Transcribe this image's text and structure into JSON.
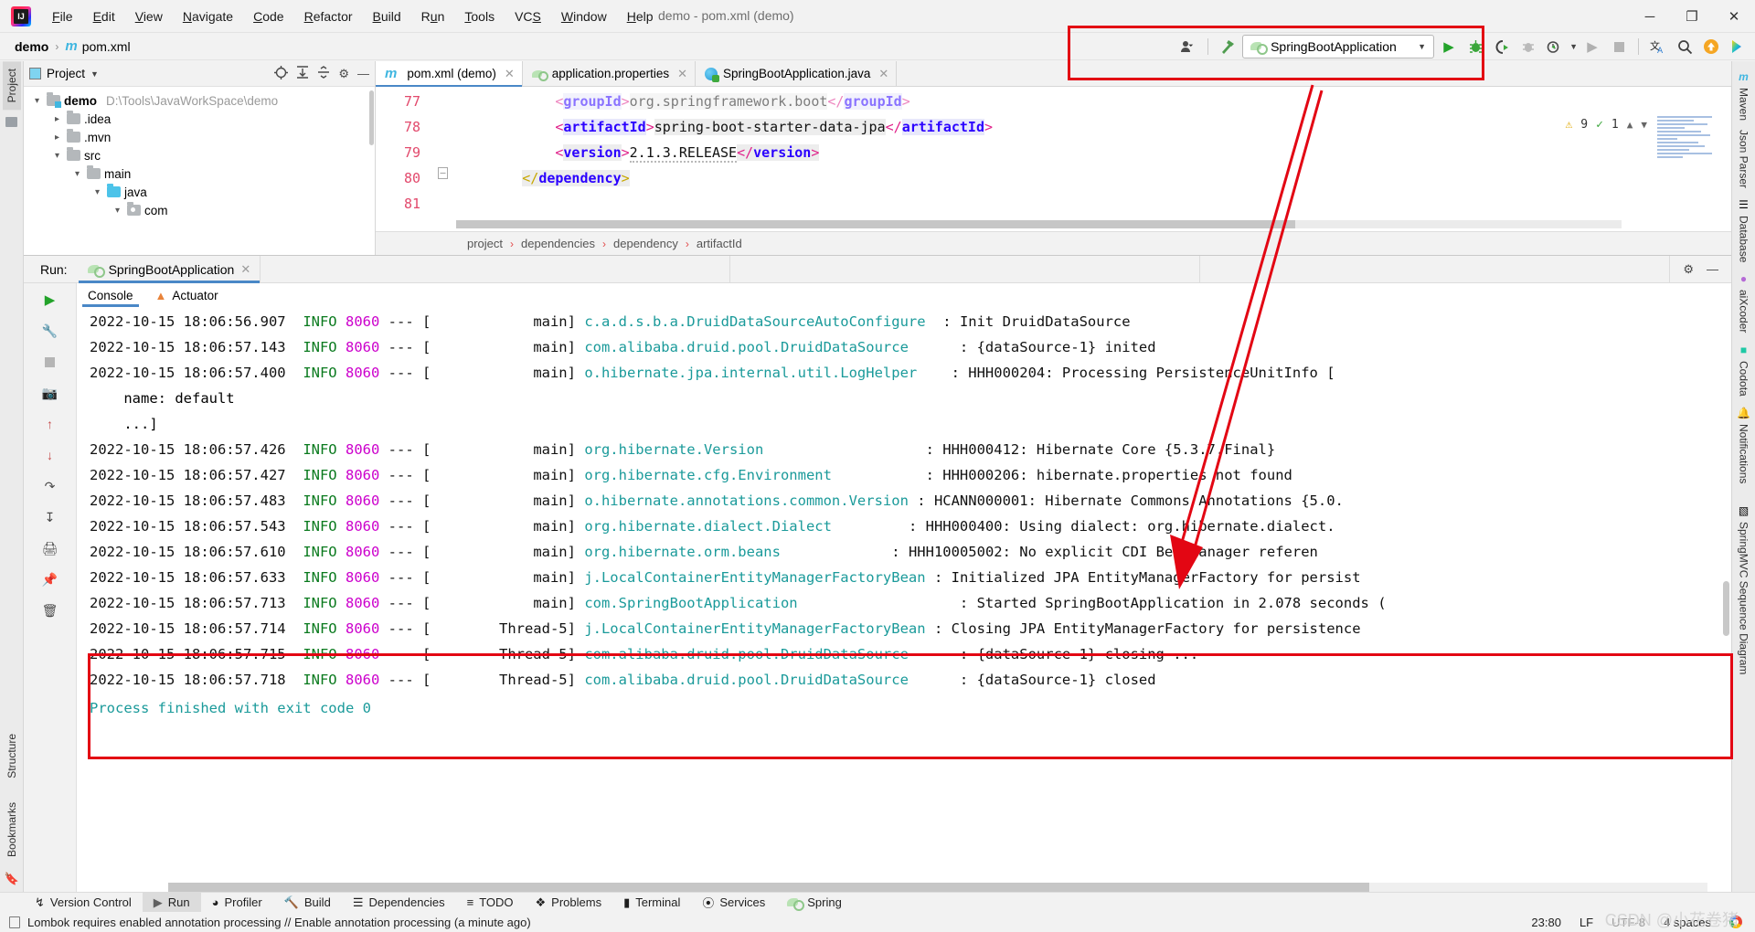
{
  "window": {
    "title": "demo - pom.xml (demo)",
    "controls": {
      "minimize": "─",
      "maximize": "❐",
      "close": "✕"
    }
  },
  "menu": [
    {
      "label": "File",
      "mnemonic": "F"
    },
    {
      "label": "Edit",
      "mnemonic": "E"
    },
    {
      "label": "View",
      "mnemonic": "V"
    },
    {
      "label": "Navigate",
      "mnemonic": "N"
    },
    {
      "label": "Code",
      "mnemonic": "C"
    },
    {
      "label": "Refactor",
      "mnemonic": "R"
    },
    {
      "label": "Build",
      "mnemonic": "B"
    },
    {
      "label": "Run",
      "mnemonic": "u"
    },
    {
      "label": "Tools",
      "mnemonic": "T"
    },
    {
      "label": "VCS",
      "mnemonic": "S"
    },
    {
      "label": "Window",
      "mnemonic": "W"
    },
    {
      "label": "Help",
      "mnemonic": "H"
    }
  ],
  "navbar": {
    "project": "demo",
    "file": "pom.xml",
    "separator": "›"
  },
  "run_toolbar": {
    "config_name": "SpringBootApplication",
    "dropdown_caret": "▼",
    "icons": [
      "user-dropdown-icon",
      "hammer-build-icon",
      "run-icon",
      "debug-icon",
      "run-with-coverage-icon",
      "profiler-icon",
      "run-dashboard-icon",
      "stop-icon",
      "translate-icon",
      "search-everywhere-icon",
      "update-icon",
      "idea-assistant-icon"
    ]
  },
  "project_panel": {
    "title": "Project",
    "caret": "▼",
    "toolbar_icons": [
      "locate-icon",
      "expand-all-icon",
      "collapse-all-icon",
      "settings-gear-icon",
      "hide-icon"
    ],
    "tree": [
      {
        "label": "demo",
        "path": "D:\\Tools\\JavaWorkSpace\\demo",
        "depth": 0,
        "expanded": true,
        "bold": true,
        "kind": "module"
      },
      {
        "label": ".idea",
        "path": "",
        "depth": 1,
        "expanded": false,
        "bold": false,
        "kind": "folder"
      },
      {
        "label": ".mvn",
        "path": "",
        "depth": 1,
        "expanded": false,
        "bold": false,
        "kind": "folder"
      },
      {
        "label": "src",
        "path": "",
        "depth": 1,
        "expanded": true,
        "bold": false,
        "kind": "folder"
      },
      {
        "label": "main",
        "path": "",
        "depth": 2,
        "expanded": true,
        "bold": false,
        "kind": "folder"
      },
      {
        "label": "java",
        "path": "",
        "depth": 3,
        "expanded": true,
        "bold": false,
        "kind": "source"
      },
      {
        "label": "com",
        "path": "",
        "depth": 4,
        "expanded": true,
        "bold": false,
        "kind": "package"
      }
    ]
  },
  "editor": {
    "tabs": [
      {
        "label": "pom.xml (demo)",
        "icon": "maven-icon",
        "active": true,
        "close": "✕"
      },
      {
        "label": "application.properties",
        "icon": "spring-properties-icon",
        "active": false,
        "close": "✕"
      },
      {
        "label": "SpringBootApplication.java",
        "icon": "spring-java-icon",
        "active": false,
        "close": "✕"
      }
    ],
    "line_numbers": [
      "77",
      "78",
      "79",
      "80",
      "81"
    ],
    "lines": [
      {
        "indent": 12,
        "parts": [
          {
            "t": "<",
            "c": "tag"
          },
          {
            "t": "groupId",
            "c": "tagname"
          },
          {
            "t": ">",
            "c": "tag"
          },
          {
            "t": "org.springframework.boot",
            "c": "txt"
          },
          {
            "t": "</",
            "c": "tag"
          },
          {
            "t": "groupId",
            "c": "tagname"
          },
          {
            "t": ">",
            "c": "tag"
          }
        ]
      },
      {
        "indent": 12,
        "parts": [
          {
            "t": "<",
            "c": "tag"
          },
          {
            "t": "artifactId",
            "c": "tagname"
          },
          {
            "t": ">",
            "c": "tag"
          },
          {
            "t": "spring-boot-starter-data-jpa",
            "c": "txt"
          },
          {
            "t": "</",
            "c": "tag"
          },
          {
            "t": "artifactId",
            "c": "tagname"
          },
          {
            "t": ">",
            "c": "tag"
          }
        ]
      },
      {
        "indent": 12,
        "parts": [
          {
            "t": "<",
            "c": "tag"
          },
          {
            "t": "version",
            "c": "tagname"
          },
          {
            "t": ">",
            "c": "tag"
          },
          {
            "t": "2.1.3.RELEASE",
            "c": "txt"
          },
          {
            "t": "</",
            "c": "tag"
          },
          {
            "t": "version",
            "c": "tagname"
          },
          {
            "t": ">",
            "c": "tag"
          }
        ]
      },
      {
        "indent": 8,
        "parts": [
          {
            "t": "</",
            "c": "closetag"
          },
          {
            "t": "dependency",
            "c": "tagname"
          },
          {
            "t": ">",
            "c": "closetag"
          }
        ]
      },
      {
        "indent": 0,
        "parts": []
      }
    ],
    "inspection": {
      "warnings": "9",
      "warning_icon": "⚠",
      "ok": "1",
      "ok_icon": "✔",
      "up": "⌃",
      "down": "⌄"
    },
    "breadcrumb": [
      "project",
      "dependencies",
      "dependency",
      "artifactId"
    ],
    "breadcrumb_sep": "›"
  },
  "run_window": {
    "label": "Run:",
    "tab": "SpringBootApplication",
    "tab_close": "✕",
    "subtabs": [
      {
        "label": "Console",
        "active": true
      },
      {
        "label": "Actuator",
        "active": false
      }
    ],
    "gutter_icons": [
      "rerun-icon",
      "wrench-icon",
      "stop-icon",
      "camera-icon",
      "up-arrow-icon",
      "down-arrow-icon",
      "soft-wrap-icon",
      "scroll-to-end-icon",
      "print-icon",
      "clear-all-icon",
      "pin-icon"
    ],
    "header_icons": [
      "settings-gear-icon",
      "hide-icon"
    ],
    "log_lines": [
      {
        "ts": "2022-10-15 18:06:56.907",
        "level": "INFO",
        "pid": "8060",
        "thread": "main",
        "logger": "c.a.d.s.b.a.DruidDataSourceAutoConfigure",
        "msg": "Init DruidDataSource"
      },
      {
        "ts": "2022-10-15 18:06:57.143",
        "level": "INFO",
        "pid": "8060",
        "thread": "main",
        "logger": "com.alibaba.druid.pool.DruidDataSource",
        "msg": "{dataSource-1} inited"
      },
      {
        "ts": "2022-10-15 18:06:57.400",
        "level": "INFO",
        "pid": "8060",
        "thread": "main",
        "logger": "o.hibernate.jpa.internal.util.LogHelper",
        "msg": "HHH000204: Processing PersistenceUnitInfo ["
      },
      {
        "plain": "    name: default"
      },
      {
        "plain": "    ...]"
      },
      {
        "ts": "2022-10-15 18:06:57.426",
        "level": "INFO",
        "pid": "8060",
        "thread": "main",
        "logger": "org.hibernate.Version",
        "msg": "HHH000412: Hibernate Core {5.3.7.Final}"
      },
      {
        "ts": "2022-10-15 18:06:57.427",
        "level": "INFO",
        "pid": "8060",
        "thread": "main",
        "logger": "org.hibernate.cfg.Environment",
        "msg": "HHH000206: hibernate.properties not found"
      },
      {
        "ts": "2022-10-15 18:06:57.483",
        "level": "INFO",
        "pid": "8060",
        "thread": "main",
        "logger": "o.hibernate.annotations.common.Version",
        "msg": "HCANN000001: Hibernate Commons Annotations {5.0."
      },
      {
        "ts": "2022-10-15 18:06:57.543",
        "level": "INFO",
        "pid": "8060",
        "thread": "main",
        "logger": "org.hibernate.dialect.Dialect",
        "msg": "HHH000400: Using dialect: org.hibernate.dialect."
      },
      {
        "ts": "2022-10-15 18:06:57.610",
        "level": "INFO",
        "pid": "8060",
        "thread": "main",
        "logger": "org.hibernate.orm.beans",
        "msg": "HHH10005002: No explicit CDI BeanManager referen"
      },
      {
        "ts": "2022-10-15 18:06:57.633",
        "level": "INFO",
        "pid": "8060",
        "thread": "main",
        "logger": "j.LocalContainerEntityManagerFactoryBean",
        "msg": "Initialized JPA EntityManagerFactory for persist"
      },
      {
        "ts": "2022-10-15 18:06:57.713",
        "level": "INFO",
        "pid": "8060",
        "thread": "main",
        "logger": "com.SpringBootApplication",
        "msg": "Started SpringBootApplication in 2.078 seconds ("
      },
      {
        "ts": "2022-10-15 18:06:57.714",
        "level": "INFO",
        "pid": "8060",
        "thread": "Thread-5",
        "logger": "j.LocalContainerEntityManagerFactoryBean",
        "msg": "Closing JPA EntityManagerFactory for persistence"
      },
      {
        "ts": "2022-10-15 18:06:57.715",
        "level": "INFO",
        "pid": "8060",
        "thread": "Thread-5",
        "logger": "com.alibaba.druid.pool.DruidDataSource",
        "msg": "{dataSource-1} closing ..."
      },
      {
        "ts": "2022-10-15 18:06:57.718",
        "level": "INFO",
        "pid": "8060",
        "thread": "Thread-5",
        "logger": "com.alibaba.druid.pool.DruidDataSource",
        "msg": "{dataSource-1} closed"
      }
    ],
    "exit_message": "Process finished with exit code 0"
  },
  "left_strip": {
    "tabs": [
      "Project",
      "Bookmarks",
      "Structure"
    ]
  },
  "right_strip": {
    "tabs": [
      "Maven",
      "Json Parser",
      "Database",
      "aiXcoder",
      "Codota",
      "Notifications",
      "SpringMVC Sequence Diagram"
    ]
  },
  "status_bar": {
    "items": [
      {
        "label": "Version Control",
        "icon": "branch-icon",
        "active": false
      },
      {
        "label": "Run",
        "icon": "run-icon",
        "active": true
      },
      {
        "label": "Profiler",
        "icon": "profiler-icon",
        "active": false
      },
      {
        "label": "Build",
        "icon": "hammer-icon",
        "active": false
      },
      {
        "label": "Dependencies",
        "icon": "layers-icon",
        "active": false
      },
      {
        "label": "TODO",
        "icon": "todo-list-icon",
        "active": false
      },
      {
        "label": "Problems",
        "icon": "problems-icon",
        "active": false
      },
      {
        "label": "Terminal",
        "icon": "terminal-icon",
        "active": false
      },
      {
        "label": "Services",
        "icon": "services-icon",
        "active": false
      },
      {
        "label": "Spring",
        "icon": "spring-leaf-icon",
        "active": false
      }
    ]
  },
  "bottom_bar": {
    "message": "Lombok requires enabled annotation processing // Enable annotation processing (a minute ago)",
    "caret_position": "23:80",
    "line_separator": "LF",
    "encoding": "UTF-8",
    "indent": "4 spaces",
    "watermark": "CSDN @小花卷猪"
  },
  "colors": {
    "accent_blue": "#4a88c7",
    "annotation_red": "#e30613",
    "log_level_green": "#0a7a1e",
    "log_pid_magenta": "#cc00cc",
    "logger_teal": "#1a9a9a",
    "gutter_pink": "#e2496c"
  }
}
